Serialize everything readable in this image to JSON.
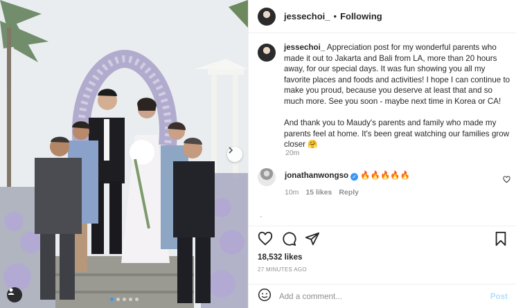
{
  "post": {
    "image_alt": "Wedding family photo under floral arch",
    "carousel_count": 5,
    "carousel_active": 0
  },
  "header": {
    "username": "jessechoi_",
    "separator": "•",
    "follow_status": "Following"
  },
  "caption": {
    "username": "jessechoi_",
    "paragraph1": "Appreciation post for my wonderful parents who made it out to Jakarta and Bali from LA, more than 20 hours away, for our special days. It was fun showing you all my favorite places and foods and activities! I hope I can continue to make you proud, because you deserve at least that and so much more. See you soon - maybe next time in Korea or CA!",
    "paragraph2": "And thank you to Maudy's parents and family who made my parents feel at home. It's been great watching our families grow closer 🤗",
    "time": "20m"
  },
  "comments": [
    {
      "username": "jonathanwongso",
      "verified": true,
      "text": "🔥🔥🔥🔥🔥",
      "time": "10m",
      "likes": "15 likes",
      "reply_label": "Reply"
    }
  ],
  "actions": {
    "likes": "18,532 likes",
    "posted": "27 MINUTES AGO"
  },
  "add_comment": {
    "placeholder": "Add a comment...",
    "post_label": "Post"
  },
  "icons": {
    "like": "heart-icon",
    "comment": "comment-icon",
    "share": "share-icon",
    "save": "bookmark-icon",
    "emoji": "emoji-icon",
    "next": "chevron-right-icon",
    "tag": "user-tag-icon"
  },
  "colors": {
    "accent": "#3897f0",
    "post_disabled": "#b2dffc",
    "secondary_text": "#8e8e8e"
  }
}
